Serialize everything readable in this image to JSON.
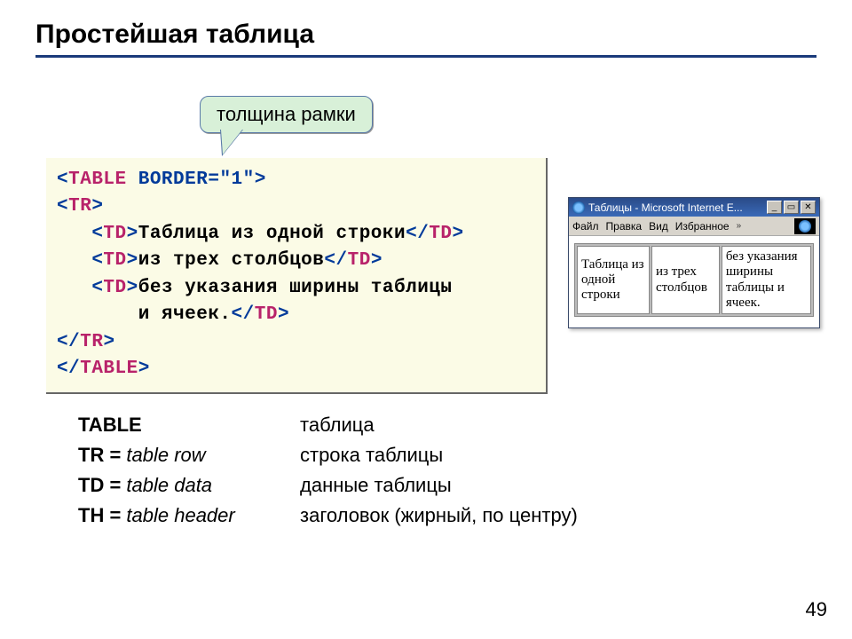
{
  "title": "Простейшая таблица",
  "callout": "толщина рамки",
  "code": {
    "l1_open": "<",
    "l1_kw": "TABLE",
    "l1_rest": " BORDER=\"1\">",
    "l2_open": "<",
    "l2_kw": "TR",
    "l2_close": ">",
    "td_open_lt": "<",
    "td_kw": "TD",
    "td_open_gt": ">",
    "td_close_lt": "</",
    "td_close_gt": ">",
    "cell1": "Таблица из одной строки",
    "cell2": "из трех столбцов",
    "cell3a": "без указания ширины таблицы",
    "cell3b": "и ячеек.",
    "tr_close_lt": "</",
    "tr_close_kw": "TR",
    "tr_close_gt": ">",
    "table_close_lt": "</",
    "table_close_kw": "TABLE",
    "table_close_gt": ">"
  },
  "browser": {
    "title": "Таблицы - Microsoft Internet E...",
    "menu": {
      "file": "Файл",
      "edit": "Правка",
      "view": "Вид",
      "fav": "Избранное"
    },
    "cells": {
      "c1": "Таблица из одной строки",
      "c2": "из трех столбцов",
      "c3": "без указания ширины таблицы и ячеек."
    },
    "buttons": {
      "min": "_",
      "max": "▭",
      "close": "✕"
    }
  },
  "glossary": {
    "r1": {
      "term_b": "TABLE",
      "term_rest": "",
      "desc": "таблица"
    },
    "r2": {
      "term_b": "TR = ",
      "term_i": "table row",
      "desc": "строка таблицы"
    },
    "r3": {
      "term_b": "TD = ",
      "term_i": "table data",
      "desc": "данные таблицы"
    },
    "r4": {
      "term_b": "TH = ",
      "term_i": "table header",
      "desc": "заголовок (жирный, по центру)"
    }
  },
  "page_number": "49"
}
